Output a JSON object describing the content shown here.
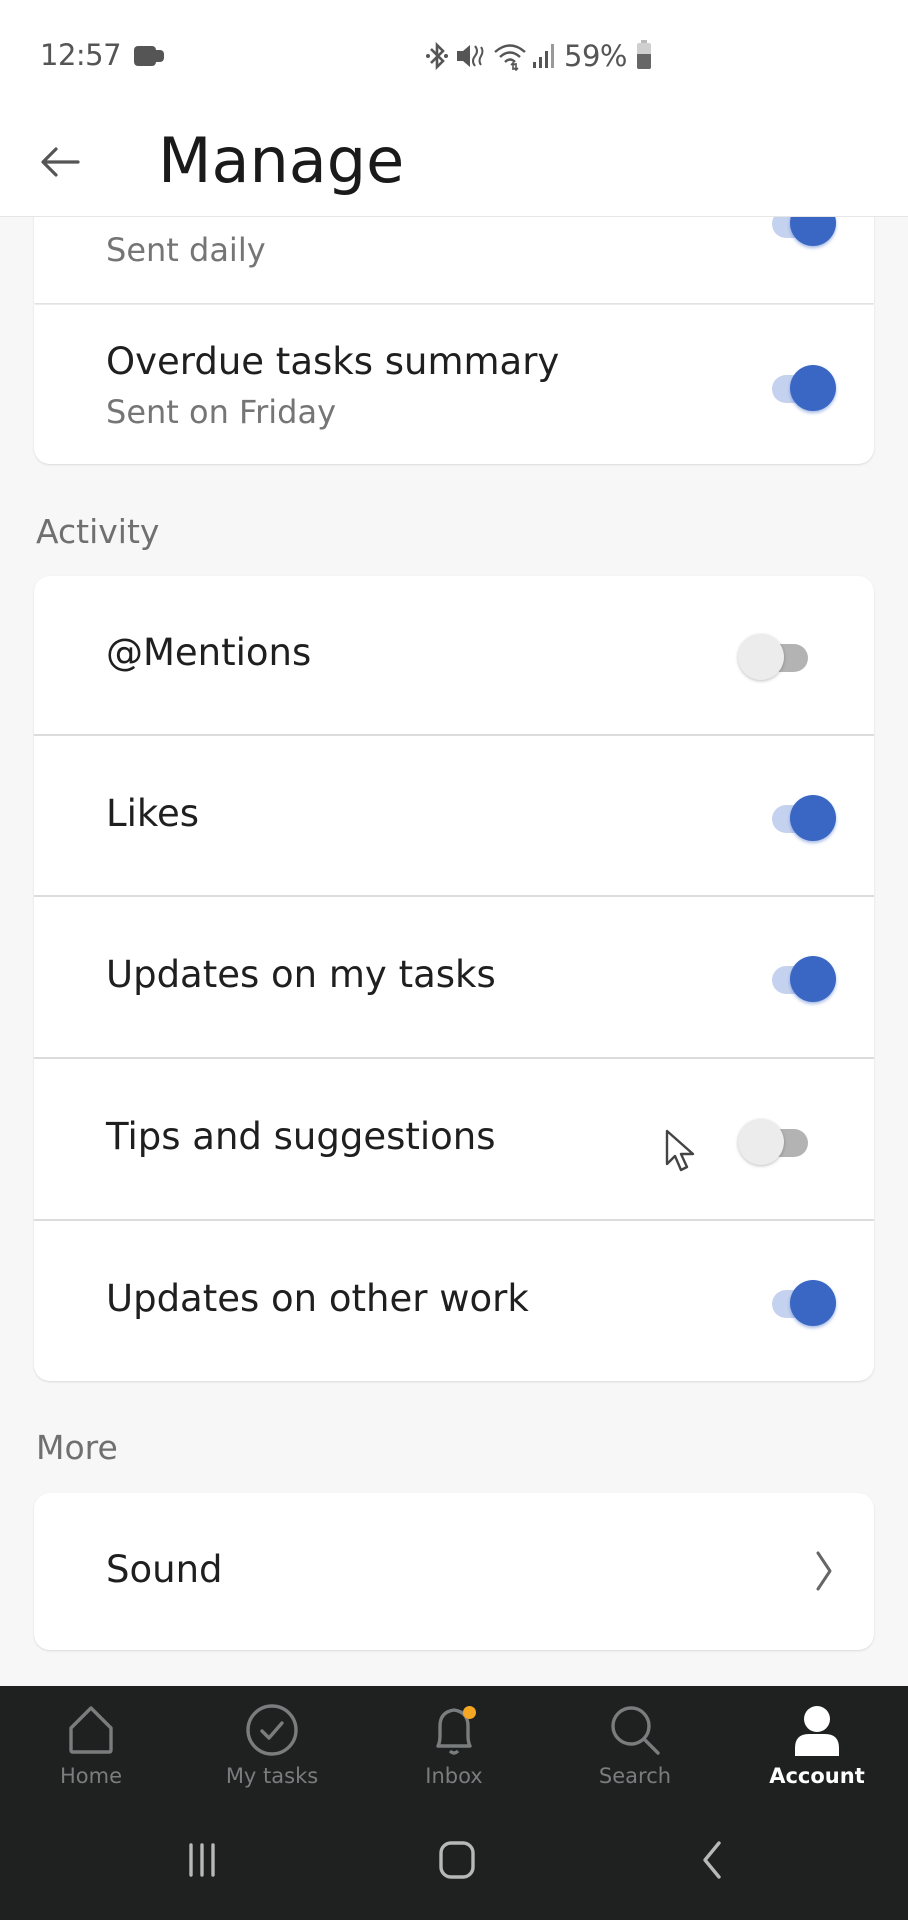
{
  "status_bar": {
    "time": "12:57",
    "battery_percent": "59%",
    "battery_level": 0.59,
    "icons": [
      "video-record-icon",
      "bluetooth-icon",
      "mute-icon",
      "wifi-icon",
      "signal-icon",
      "battery-icon"
    ]
  },
  "header": {
    "title": "Manage",
    "back_icon": "arrow-left-icon"
  },
  "partial_card": {
    "subtitle": "Sent daily",
    "enabled": true
  },
  "summary_card": {
    "items": [
      {
        "title": "Overdue tasks summary",
        "subtitle": "Sent on Friday",
        "enabled": true
      }
    ]
  },
  "activity": {
    "label": "Activity",
    "items": [
      {
        "title": "@Mentions",
        "enabled": false
      },
      {
        "title": "Likes",
        "enabled": true
      },
      {
        "title": "Updates on my tasks",
        "enabled": true
      },
      {
        "title": "Tips and suggestions",
        "enabled": false
      },
      {
        "title": "Updates on other work",
        "enabled": true
      }
    ]
  },
  "more": {
    "label": "More",
    "items": [
      {
        "title": "Sound",
        "icon": "chevron-right-icon"
      }
    ]
  },
  "bottom_nav": {
    "items": [
      {
        "label": "Home",
        "icon": "home-icon",
        "active": false
      },
      {
        "label": "My tasks",
        "icon": "check-circle-icon",
        "active": false
      },
      {
        "label": "Inbox",
        "icon": "bell-icon",
        "active": false,
        "badge": true
      },
      {
        "label": "Search",
        "icon": "search-icon",
        "active": false
      },
      {
        "label": "Account",
        "icon": "person-icon",
        "active": true
      }
    ]
  },
  "system_nav": {
    "items": [
      "recent-apps-icon",
      "home-circle-icon",
      "back-chevron-icon"
    ]
  },
  "colors": {
    "accent": "#3a66c4",
    "accent_track": "#c5d2ef",
    "badge": "#f5a623",
    "nav_bg": "#1f2121"
  }
}
